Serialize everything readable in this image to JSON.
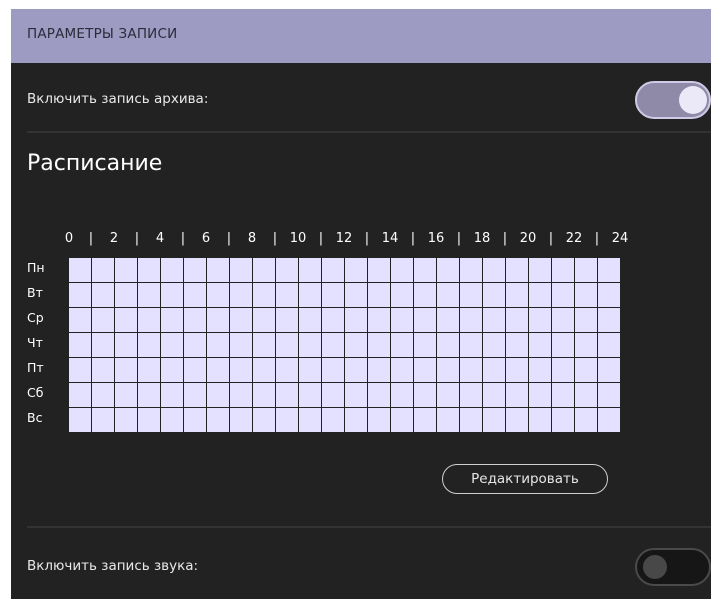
{
  "header": {
    "title": "ПАРАМЕТРЫ ЗАПИСИ"
  },
  "archive": {
    "label": "Включить запись архива:",
    "enabled": true
  },
  "schedule": {
    "title": "Расписание",
    "hour_labels": [
      "0",
      "|",
      "2",
      "|",
      "4",
      "|",
      "6",
      "|",
      "8",
      "|",
      "10",
      "|",
      "12",
      "|",
      "14",
      "|",
      "16",
      "|",
      "18",
      "|",
      "20",
      "|",
      "22",
      "|",
      "24"
    ],
    "days": [
      "Пн",
      "Вт",
      "Ср",
      "Чт",
      "Пт",
      "Сб",
      "Вс"
    ],
    "slots_per_day": 24,
    "all_slots_enabled": true,
    "edit_label": "Редактировать"
  },
  "sound": {
    "label": "Включить запись звука:",
    "enabled": false
  },
  "colors": {
    "header_bg": "#9e9bc2",
    "panel_bg": "#222222",
    "slot_on": "#e3e1ff",
    "toggle_on": "#8f8aa8"
  }
}
